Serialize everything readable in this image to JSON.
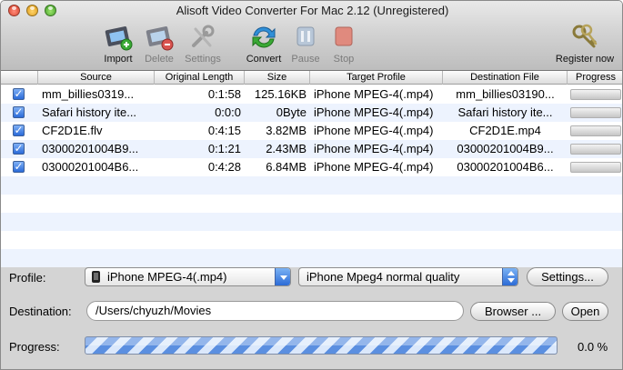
{
  "window": {
    "title": "Alisoft Video Converter For Mac 2.12 (Unregistered)"
  },
  "toolbar": {
    "import_label": "Import",
    "delete_label": "Delete",
    "settings_label": "Settings",
    "convert_label": "Convert",
    "pause_label": "Pause",
    "stop_label": "Stop",
    "register_label": "Register now"
  },
  "table": {
    "columns": [
      "Source",
      "Original Length",
      "Size",
      "Target Profile",
      "Destination File",
      "Progress"
    ],
    "rows": [
      {
        "source": "mm_billies0319...",
        "length": "0:1:58",
        "size": "125.16KB",
        "profile": "iPhone MPEG-4(.mp4)",
        "dest": "mm_billies03190...",
        "progress": 0
      },
      {
        "source": "Safari history ite...",
        "length": "0:0:0",
        "size": "0Byte",
        "profile": "iPhone MPEG-4(.mp4)",
        "dest": "Safari history ite...",
        "progress": 0
      },
      {
        "source": "CF2D1E.flv",
        "length": "0:4:15",
        "size": "3.82MB",
        "profile": "iPhone MPEG-4(.mp4)",
        "dest": "CF2D1E.mp4",
        "progress": 0
      },
      {
        "source": "03000201004B9...",
        "length": "0:1:21",
        "size": "2.43MB",
        "profile": "iPhone MPEG-4(.mp4)",
        "dest": "03000201004B9...",
        "progress": 0
      },
      {
        "source": "03000201004B6...",
        "length": "0:4:28",
        "size": "6.84MB",
        "profile": "iPhone MPEG-4(.mp4)",
        "dest": "03000201004B6...",
        "progress": 0
      }
    ]
  },
  "controls": {
    "profile_label": "Profile:",
    "profile_value": "iPhone MPEG-4(.mp4)",
    "quality_value": "iPhone Mpeg4 normal quality",
    "settings_button": "Settings...",
    "destination_label": "Destination:",
    "destination_value": "/Users/chyuzh/Movies",
    "browser_button": "Browser ...",
    "open_button": "Open",
    "progress_label": "Progress:",
    "progress_value": "0.0 %"
  },
  "colors": {
    "accent": "#2c6bd6",
    "row_alt": "#edf3fe"
  }
}
